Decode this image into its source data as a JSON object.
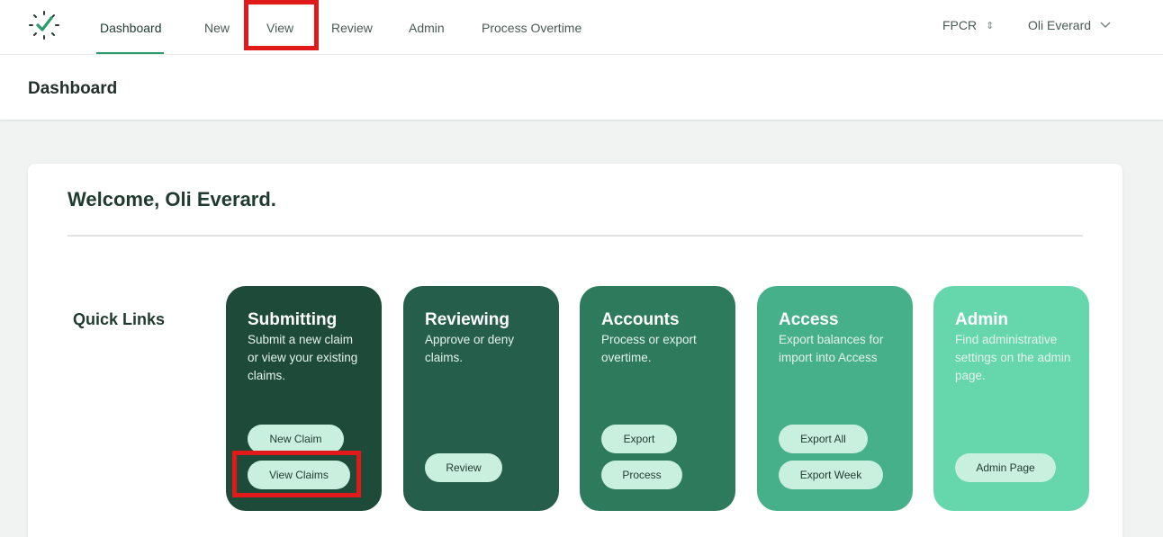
{
  "nav": {
    "items": [
      {
        "label": "Dashboard"
      },
      {
        "label": "New"
      },
      {
        "label": "View"
      },
      {
        "label": "Review"
      },
      {
        "label": "Admin"
      },
      {
        "label": "Process Overtime"
      }
    ],
    "org": "FPCR",
    "user": "Oli Everard"
  },
  "header": {
    "title": "Dashboard"
  },
  "main": {
    "welcome": "Welcome, Oli Everard.",
    "quick_links_label": "Quick Links",
    "tiles": [
      {
        "title": "Submitting",
        "description": "Submit a new claim or view your existing claims.",
        "color": "#1e4a3a",
        "buttons": [
          "New Claim",
          "View Claims"
        ]
      },
      {
        "title": "Reviewing",
        "description": "Approve or deny claims.",
        "color": "#255f4b",
        "buttons": [
          "Review"
        ]
      },
      {
        "title": "Accounts",
        "description": "Process or export overtime.",
        "color": "#2e7a5d",
        "buttons": [
          "Export",
          "Process"
        ]
      },
      {
        "title": "Access",
        "description": "Export balances for import into Access",
        "color": "#46b08a",
        "buttons": [
          "Export All",
          "Export Week"
        ]
      },
      {
        "title": "Admin",
        "description": "Find administrative settings on the admin page.",
        "color": "#66d6ac",
        "buttons": [
          "Admin Page"
        ]
      }
    ]
  },
  "colors": {
    "accent": "#2b9c6e",
    "highlight": "#e01919",
    "button_bg": "#c9efdf"
  }
}
